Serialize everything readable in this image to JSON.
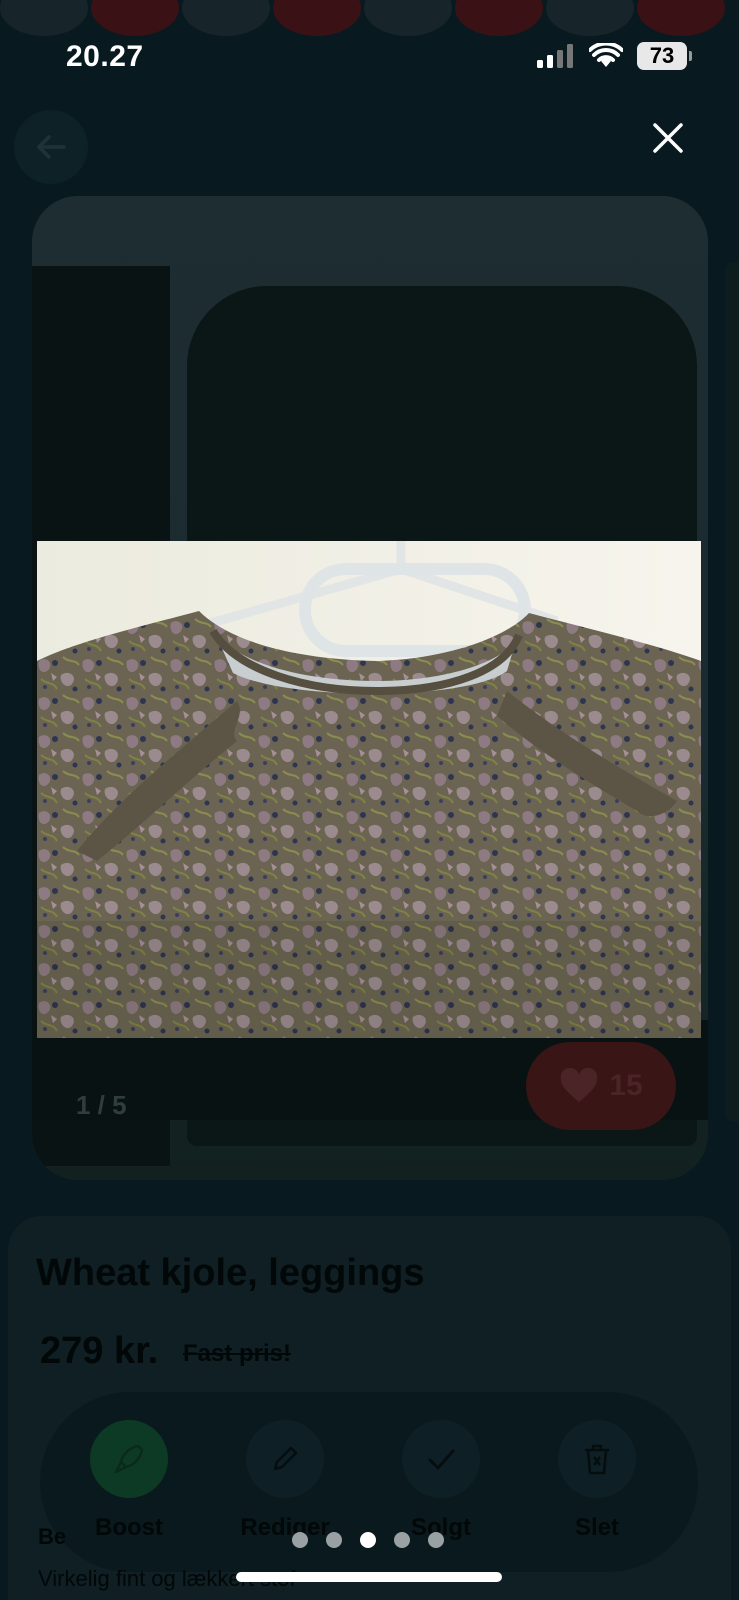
{
  "status_bar": {
    "time": "20.27",
    "battery": "73"
  },
  "listing": {
    "title": "Wheat kjole, leggings",
    "price": "279 kr.",
    "price_note": "Fast pris!",
    "likes": "15",
    "photo_counter": "1 / 5",
    "description_prefix": "Be",
    "description_text": "Virkelig fint og lækkert stof"
  },
  "actions": [
    {
      "label": "Boost",
      "icon": "rocket-icon"
    },
    {
      "label": "Rediger",
      "icon": "pencil-icon"
    },
    {
      "label": "Solgt",
      "icon": "check-icon"
    },
    {
      "label": "Slet",
      "icon": "trash-icon"
    }
  ],
  "viewer": {
    "page_count": 5,
    "active_page": 3
  },
  "colors": {
    "boost_accent": "#0d3a24",
    "like_accent": "#3a1516",
    "background": "#081a20"
  }
}
